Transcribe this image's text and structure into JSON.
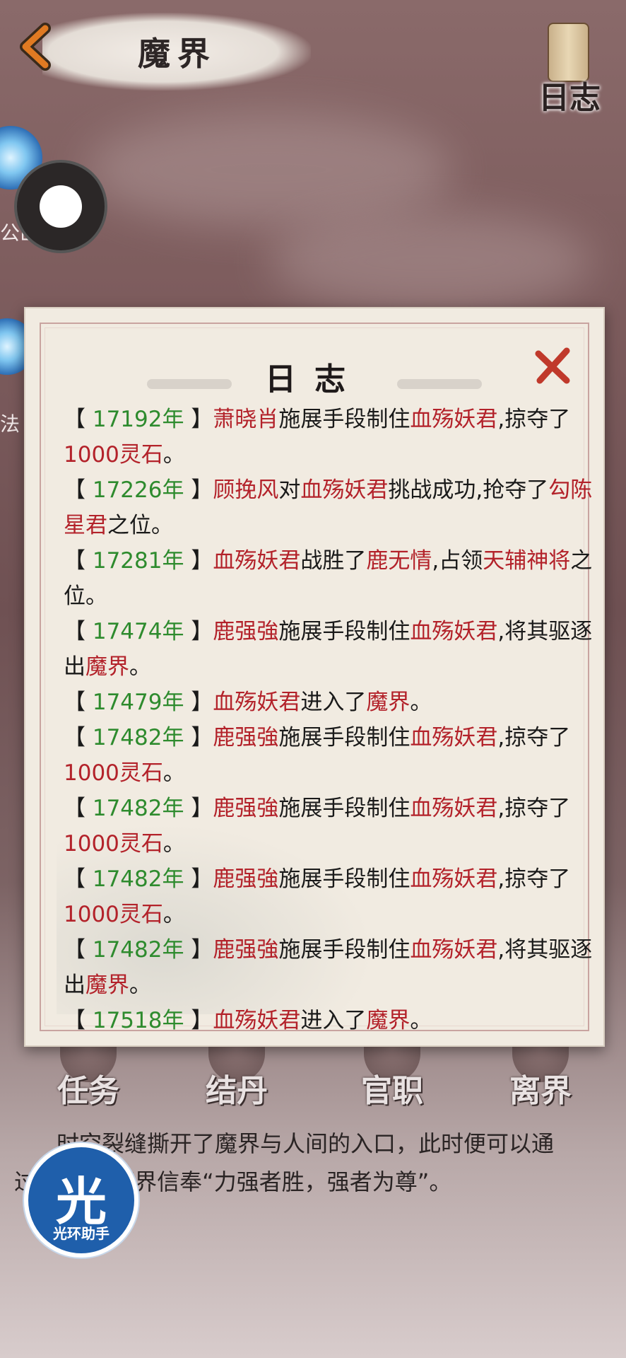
{
  "header": {
    "title": "魔界",
    "log_button_label": "日志"
  },
  "side": {
    "label_1": "公山",
    "label_2": "法"
  },
  "dialog": {
    "title": "日志",
    "entries": [
      {
        "year": "17192年",
        "parts": [
          {
            "t": "萧晓肖",
            "c": "red"
          },
          {
            "t": "施展手段制住",
            "c": "black"
          },
          {
            "t": "血殇妖君",
            "c": "red"
          },
          {
            "t": ",掠夺了",
            "c": "black"
          },
          {
            "t": "1000灵石",
            "c": "red"
          },
          {
            "t": "。",
            "c": "black"
          }
        ]
      },
      {
        "year": "17226年",
        "parts": [
          {
            "t": "顾挽风",
            "c": "red"
          },
          {
            "t": "对",
            "c": "black"
          },
          {
            "t": "血殇妖君",
            "c": "red"
          },
          {
            "t": "挑战成功,抢夺了",
            "c": "black"
          },
          {
            "t": "勾陈星君",
            "c": "red"
          },
          {
            "t": "之位。",
            "c": "black"
          }
        ]
      },
      {
        "year": "17281年",
        "parts": [
          {
            "t": "血殇妖君",
            "c": "red"
          },
          {
            "t": "战胜了",
            "c": "black"
          },
          {
            "t": "鹿无情",
            "c": "red"
          },
          {
            "t": ",占领",
            "c": "black"
          },
          {
            "t": "天辅神将",
            "c": "red"
          },
          {
            "t": "之位。",
            "c": "black"
          }
        ]
      },
      {
        "year": "17474年",
        "parts": [
          {
            "t": "鹿强強",
            "c": "red"
          },
          {
            "t": "施展手段制住",
            "c": "black"
          },
          {
            "t": "血殇妖君",
            "c": "red"
          },
          {
            "t": ",将其驱逐出",
            "c": "black"
          },
          {
            "t": "魔界",
            "c": "red"
          },
          {
            "t": "。",
            "c": "black"
          }
        ]
      },
      {
        "year": "17479年",
        "parts": [
          {
            "t": "血殇妖君",
            "c": "red"
          },
          {
            "t": "进入了",
            "c": "black"
          },
          {
            "t": "魔界",
            "c": "red"
          },
          {
            "t": "。",
            "c": "black"
          }
        ]
      },
      {
        "year": "17482年",
        "parts": [
          {
            "t": "鹿强強",
            "c": "red"
          },
          {
            "t": "施展手段制住",
            "c": "black"
          },
          {
            "t": "血殇妖君",
            "c": "red"
          },
          {
            "t": ",掠夺了",
            "c": "black"
          },
          {
            "t": "1000灵石",
            "c": "red"
          },
          {
            "t": "。",
            "c": "black"
          }
        ]
      },
      {
        "year": "17482年",
        "parts": [
          {
            "t": "鹿强強",
            "c": "red"
          },
          {
            "t": "施展手段制住",
            "c": "black"
          },
          {
            "t": "血殇妖君",
            "c": "red"
          },
          {
            "t": ",掠夺了",
            "c": "black"
          },
          {
            "t": "1000灵石",
            "c": "red"
          },
          {
            "t": "。",
            "c": "black"
          }
        ]
      },
      {
        "year": "17482年",
        "parts": [
          {
            "t": "鹿强強",
            "c": "red"
          },
          {
            "t": "施展手段制住",
            "c": "black"
          },
          {
            "t": "血殇妖君",
            "c": "red"
          },
          {
            "t": ",掠夺了",
            "c": "black"
          },
          {
            "t": "1000灵石",
            "c": "red"
          },
          {
            "t": "。",
            "c": "black"
          }
        ]
      },
      {
        "year": "17482年",
        "parts": [
          {
            "t": "鹿强強",
            "c": "red"
          },
          {
            "t": "施展手段制住",
            "c": "black"
          },
          {
            "t": "血殇妖君",
            "c": "red"
          },
          {
            "t": ",将其驱逐出",
            "c": "black"
          },
          {
            "t": "魔界",
            "c": "red"
          },
          {
            "t": "。",
            "c": "black"
          }
        ]
      },
      {
        "year": "17518年",
        "parts": [
          {
            "t": "血殇妖君",
            "c": "red"
          },
          {
            "t": "进入了",
            "c": "black"
          },
          {
            "t": "魔界",
            "c": "red"
          },
          {
            "t": "。",
            "c": "black"
          }
        ]
      }
    ]
  },
  "bottom_nav": [
    "任务",
    "结丹",
    "官职",
    "离界"
  ],
  "description": {
    "line_1": "时空裂缝撕开了魔界与人间的入口，此时便可以通",
    "line_2": "过 魔界。魔界信奉“力强者胜，强者为尊”。"
  },
  "helper_logo": {
    "big": "光",
    "small": "光环助手"
  },
  "colors": {
    "year": "#2e8b2e",
    "highlight": "#b3222a",
    "close": "#c0392b"
  }
}
